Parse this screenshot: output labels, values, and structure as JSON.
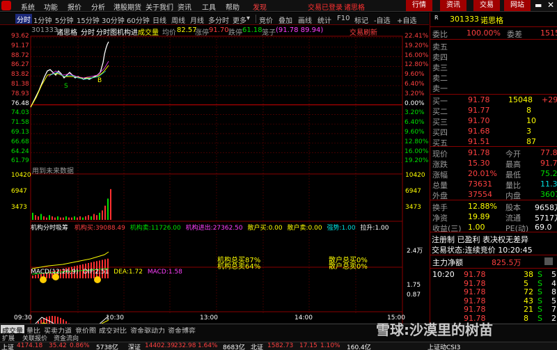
{
  "menubar": {
    "items": [
      "系统",
      "功能",
      "报价",
      "分析",
      "港股期货",
      "关于我们",
      "资讯",
      "工具",
      "帮助"
    ],
    "discover": "发现",
    "login_status": "交易已登录",
    "stock_name": "诸思格",
    "top_buttons": [
      "行情",
      "资讯",
      "交易",
      "网站"
    ]
  },
  "toolbar": {
    "left_items": [
      "分时",
      "1分钟",
      "5分钟",
      "15分钟",
      "30分钟",
      "60分钟",
      "日线",
      "周线",
      "月线",
      "多分时",
      "更多"
    ],
    "right_items": [
      "竞价",
      "叠加",
      "画线",
      "统计",
      "F10",
      "标记",
      "-自选",
      "+自选"
    ]
  },
  "chart_header": {
    "code": "301333",
    "name": "诸思格",
    "view": "分时",
    "mode": "分时图机构进",
    "volume_tab": "成交量",
    "avg_label": "均价",
    "avg_value": "82.57",
    "limit_up_label": "涨停",
    "limit_up_value": "91.70",
    "limit_down_label": "跌停",
    "limit_down_value": "61.18",
    "cursor_label": "笼子",
    "cursor_value": "(91.78 89.94)",
    "refresh": "交易刷新"
  },
  "price_axis_left": [
    "93.62",
    "91.17",
    "88.72",
    "86.27",
    "83.82",
    "81.38",
    "78.93",
    "76.48",
    "74.03",
    "71.58",
    "69.13",
    "66.68",
    "64.24",
    "61.79"
  ],
  "price_axis_right": [
    "22.41%",
    "19.20%",
    "16.00%",
    "12.80%",
    "9.60%",
    "6.40%",
    "3.20%",
    "0.00%",
    "3.20%",
    "6.40%",
    "9.60%",
    "12.80%",
    "16.00%",
    "19.20%"
  ],
  "future_label": "用到未来数据",
  "volume_axis_left": [
    "10420",
    "6947",
    "3473"
  ],
  "volume_axis_right": [
    "10420",
    "6947",
    "3473"
  ],
  "indicator1": {
    "title": "机构分时吸筹",
    "items": [
      {
        "label": "机构买:",
        "value": "39088.49"
      },
      {
        "label": "机构卖:",
        "value": "11726.00"
      },
      {
        "label": "机构进出:",
        "value": "27362.50"
      },
      {
        "label": "散户买:",
        "value": "0.00"
      },
      {
        "label": "散户卖:",
        "value": "0.00"
      },
      {
        "label": "强势:",
        "value": "1.00"
      },
      {
        "label": "拉升:",
        "value": "1.00"
      }
    ],
    "axis_value": "2.4万",
    "legend_institution": "机构总买87%",
    "legend_institution_sell": "机构总卖64%",
    "legend_retail": "散户总买0%",
    "legend_retail_sell": "散户总卖0%"
  },
  "macd": {
    "title": "MACD(12,26,9)",
    "dif_label": "DIF:",
    "dif_value": "2.51",
    "dea_label": "DEA:",
    "dea_value": "1.72",
    "macd_label": "MACD:",
    "macd_value": "1.58",
    "axis": [
      "1.75",
      "0.87"
    ]
  },
  "time_axis": [
    "09:30",
    "10:30",
    "13:00",
    "14:00",
    "15:00"
  ],
  "right_panel": {
    "code_prefix": "R",
    "code": "301333",
    "name": "诺思格",
    "weibi_label": "委比",
    "weibi_value": "100.00%",
    "weicha_label": "委差",
    "weicha_value": "15150",
    "asks": [
      "卖五",
      "卖四",
      "卖三",
      "卖二",
      "卖一"
    ],
    "bids": [
      {
        "label": "买一",
        "price": "91.78",
        "vol": "15048",
        "chg": "+29"
      },
      {
        "label": "买二",
        "price": "91.77",
        "vol": "8",
        "chg": ""
      },
      {
        "label": "买三",
        "price": "91.70",
        "vol": "10",
        "chg": ""
      },
      {
        "label": "买四",
        "price": "91.68",
        "vol": "3",
        "chg": ""
      },
      {
        "label": "买五",
        "price": "91.51",
        "vol": "87",
        "chg": ""
      }
    ],
    "stats": [
      {
        "l1": "现价",
        "v1": "91.78",
        "l2": "今开",
        "v2": "77.85"
      },
      {
        "l1": "涨跌",
        "v1": "15.30",
        "l2": "最高",
        "v2": "91.78"
      },
      {
        "l1": "涨幅",
        "v1": "20.01%",
        "l2": "最低",
        "v2": "75.22"
      },
      {
        "l1": "总量",
        "v1": "73631",
        "l2": "量比",
        "v2": "11.34"
      },
      {
        "l1": "外盘",
        "v1": "37554",
        "l2": "内盘",
        "v2": "36077"
      }
    ],
    "stats2": [
      {
        "l1": "换手",
        "v1": "12.88%",
        "l2": "股本",
        "v2": "9658万"
      },
      {
        "l1": "净资",
        "v1": "19.89",
        "l2": "流通",
        "v2": "5717万"
      },
      {
        "l1": "收益(三)",
        "v1": "1.00",
        "l2": "PE(动)",
        "v2": "69.0"
      }
    ],
    "register": "注册制 已盈利 表决权无差异",
    "trade_status": "交易状态:连续竞价 10:20:45",
    "net_label": "主力净额",
    "net_value": "825.5万",
    "ticks": [
      {
        "time": "10:20",
        "price": "91.78",
        "vol": "38",
        "dir": "S",
        "n": "5"
      },
      {
        "time": "",
        "price": "91.78",
        "vol": "5",
        "dir": "S",
        "n": "4"
      },
      {
        "time": "",
        "price": "91.78",
        "vol": "72",
        "dir": "S",
        "n": "8"
      },
      {
        "time": "",
        "price": "91.78",
        "vol": "43",
        "dir": "S",
        "n": "5"
      },
      {
        "time": "",
        "price": "91.78",
        "vol": "21",
        "dir": "S",
        "n": "7"
      },
      {
        "time": "",
        "price": "91.78",
        "vol": "8",
        "dir": "S",
        "n": "2"
      }
    ]
  },
  "bottom_tabs": [
    "成交量",
    "量比",
    "买卖力道",
    "竞价图",
    "成交对比",
    "资金驱动力",
    "资金博弈"
  ],
  "sub_tabs": [
    "扩展",
    "关联报价",
    "资金流向"
  ],
  "status_bar": [
    {
      "label": "上证",
      "value": "4174.18",
      "chg": "35.42",
      "pct": "0.86%",
      "amt": "5738亿"
    },
    {
      "label": "深证",
      "value": "14402.39",
      "chg": "232.98",
      "pct": "1.64%",
      "amt": "8683亿"
    },
    {
      "label": "北证",
      "value": "1582.73",
      "chg": "17.15",
      "pct": "1.10%",
      "amt": "160.4亿"
    }
  ],
  "status_extra": "上证动CSI3",
  "watermark": "雪球:沙漠里的树苗",
  "colors": {
    "up": "#ff4040",
    "down": "#00e000",
    "bg": "#000000",
    "grid": "#6a0000",
    "accent": "#ffff00"
  }
}
